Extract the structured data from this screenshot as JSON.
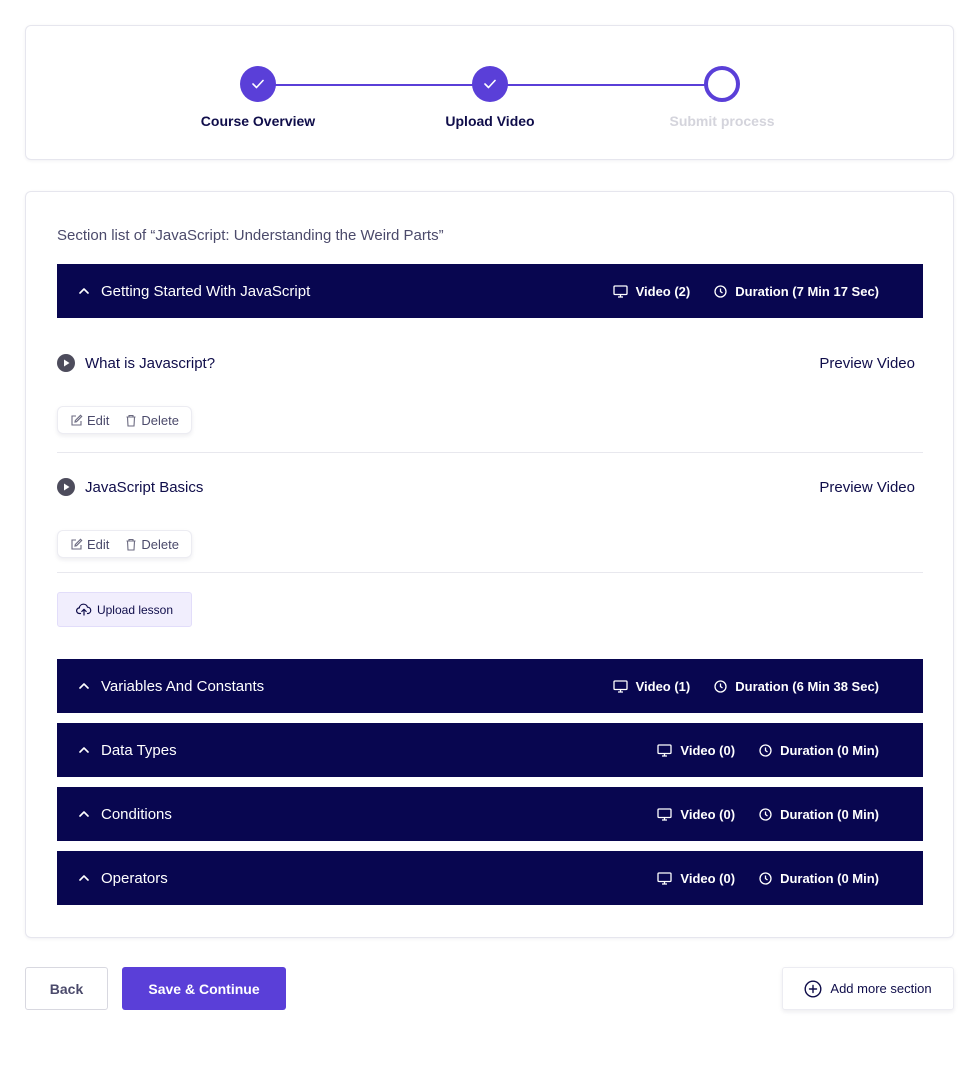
{
  "stepper": {
    "steps": [
      {
        "label": "Course Overview",
        "state": "done"
      },
      {
        "label": "Upload Video",
        "state": "done"
      },
      {
        "label": "Submit process",
        "state": "current"
      }
    ]
  },
  "sections_card": {
    "list_title": "Section list of “JavaScript: Understanding the Weird Parts”",
    "sections": [
      {
        "title": "Getting Started With JavaScript",
        "video": "Video (2)",
        "duration": "Duration (7 Min 17 Sec)",
        "expanded": true,
        "lessons": [
          {
            "title": "What is Javascript?",
            "preview": "Preview Video",
            "edit": "Edit",
            "delete": "Delete"
          },
          {
            "title": "JavaScript Basics",
            "preview": "Preview Video",
            "edit": "Edit",
            "delete": "Delete"
          }
        ],
        "upload_label": "Upload lesson"
      },
      {
        "title": "Variables And Constants",
        "video": "Video (1)",
        "duration": "Duration (6 Min 38 Sec)"
      },
      {
        "title": "Data Types",
        "video": "Video (0)",
        "duration": "Duration (0 Min)"
      },
      {
        "title": "Conditions",
        "video": "Video (0)",
        "duration": "Duration (0 Min)"
      },
      {
        "title": "Operators",
        "video": "Video (0)",
        "duration": "Duration (0 Min)"
      }
    ]
  },
  "footer": {
    "back_label": "Back",
    "save_label": "Save & Continue",
    "add_section_label": "Add more section"
  },
  "colors": {
    "accent": "#5a3fd8",
    "section_bar": "#080650",
    "text_primary": "#0f0d4a"
  }
}
